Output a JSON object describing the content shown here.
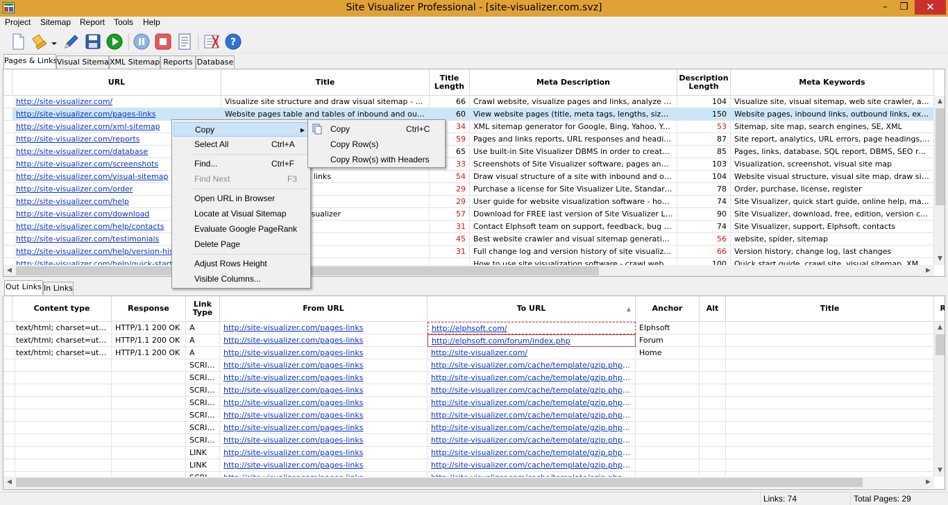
{
  "window": {
    "title": "Site Visualizer Professional - [site-visualizer.com.svz]",
    "min": "–",
    "max": "❒",
    "close": "✕"
  },
  "menu": [
    "Project",
    "Sitemap",
    "Report",
    "Tools",
    "Help"
  ],
  "toolbar_icons": [
    "new-project-icon",
    "open-project-icon",
    "dropdown-arrow-icon",
    "edit-project-icon",
    "save-project-icon",
    "start-crawl-icon",
    "pause-crawl-icon",
    "stop-crawl-icon",
    "report-icon",
    "settings-icon",
    "help-icon"
  ],
  "main_tabs": [
    "Pages & Links",
    "Visual Sitemap",
    "XML Sitemap",
    "Reports",
    "Database"
  ],
  "pages": {
    "columns": [
      "URL",
      "Title",
      "Title Length",
      "Meta Description",
      "Description Length",
      "Meta Keywords"
    ],
    "rows": [
      [
        "http://site-visualizer.com/",
        "Visualize site structure and draw visual sitemap - Site Visu...",
        "66",
        "Crawl website, visualize pages and links, analyze the stru...",
        "104",
        "Visualize site, visual sitemap, web site crawler, analyze w..."
      ],
      [
        "http://site-visualizer.com/pages-links",
        "Website pages table and tables of inbound and outbound ...",
        "60",
        "View website pages (title, meta tags, lengths, size, conte...",
        "150",
        "Website pages, inbound links, outbound links, external lin..."
      ],
      [
        "http://site-visualizer.com/xml-sitemap",
        "",
        "34",
        "XML sitemap generator for Google, Bing, Yahoo, Yandex",
        "53",
        "Sitemap, site map, search engines, SE, XML"
      ],
      [
        "http://site-visualizer.com/reports",
        "",
        "59",
        "Pages and links reports, URL responses and headings H1-...",
        "87",
        "Site report, analytics, URL errors, page headings, SEO, s..."
      ],
      [
        "http://site-visualizer.com/database",
        "",
        "65",
        "Use built-in Site Visualizer DBMS in order to create your cu...",
        "85",
        "Pages, links, database, SQL report, DBMS, SEO report"
      ],
      [
        "http://site-visualizer.com/screenshots",
        "",
        "33",
        "Screenshots of Site Visualizer software, pages and links ta...",
        "103",
        "Visualization, screenshot, visual site map"
      ],
      [
        "http://site-visualizer.com/visual-sitemap",
        "tically draw pages and links",
        "54",
        "Draw visual structure of a site with inbound and outbound...",
        "104",
        "Website visual structure, visual site map, draw site, analy..."
      ],
      [
        "http://site-visualizer.com/order",
        "e",
        "29",
        "Purchase a license for Site Visualizer Lite, Standard, or Pr...",
        "78",
        "Order, purchase, license, register"
      ],
      [
        "http://site-visualizer.com/help",
        "al",
        "29",
        "User guide for website visualization software - how to use...",
        "74",
        "Site Visualizer, quick start guide, online help, manual"
      ],
      [
        "http://site-visualizer.com/download",
        "ation software - Site Visualizer",
        "57",
        "Download for FREE last version of Site Visualizer Lite, Sta...",
        "90",
        "Site Visualizer, download, free, edition, version comparison"
      ],
      [
        "http://site-visualizer.com/help/contacts",
        "port",
        "31",
        "Contact Elphsoft team on support, feedback, bug report ...",
        "74",
        "Site Visualizer, support, Elphsoft, contacts"
      ],
      [
        "http://site-visualizer.com/testimonials",
        "nd website analysis",
        "45",
        "Best website crawler and visual sitemap generation tool!",
        "56",
        "website, spider, sitemap"
      ],
      [
        "http://site-visualizer.com/help/version-history",
        "ory",
        "31",
        "Full change log and version history of site visualization sof...",
        "66",
        "Version history, change log, last changes"
      ],
      [
        "http://site-visualizer.com/help/quick-start-guide",
        "ualizer",
        "",
        "How to use site visualization software - crawl website, cre...",
        "100",
        "Quick start guide, crawl site, visual sitemap, XML sitemap..."
      ]
    ],
    "red_title_len": [
      false,
      false,
      true,
      true,
      false,
      true,
      true,
      true,
      true,
      true,
      true,
      true,
      true,
      false
    ],
    "red_desc_len": [
      false,
      false,
      true,
      false,
      false,
      false,
      false,
      false,
      false,
      false,
      false,
      true,
      true,
      false
    ]
  },
  "link_tabs": [
    "Out Links",
    "In Links"
  ],
  "links": {
    "columns": [
      "Content type",
      "Response",
      "Link Type",
      "From URL",
      "To URL",
      "Anchor",
      "Alt",
      "Title",
      "R"
    ],
    "rows": [
      [
        "text/html; charset=utf-8",
        "HTTP/1.1 200 OK",
        "A",
        "http://site-visualizer.com/pages-links",
        "http://elphsoft.com/",
        "Elphsoft",
        "",
        ""
      ],
      [
        "text/html; charset=utf-8",
        "HTTP/1.1 200 OK",
        "A",
        "http://site-visualizer.com/pages-links",
        "http://elphsoft.com/forum/index.php",
        "Forum",
        "",
        ""
      ],
      [
        "text/html; charset=utf-8",
        "HTTP/1.1 200 OK",
        "A",
        "http://site-visualizer.com/pages-links",
        "http://site-visualizer.com/",
        "Home",
        "",
        ""
      ],
      [
        "",
        "",
        "SCRIPT",
        "http://site-visualizer.com/pages-links",
        "http://site-visualizer.com/cache/template/gzip.php?core-1...",
        "",
        "",
        ""
      ],
      [
        "",
        "",
        "SCRIPT",
        "http://site-visualizer.com/pages-links",
        "http://site-visualizer.com/cache/template/gzip.php?jquery...",
        "",
        "",
        ""
      ],
      [
        "",
        "",
        "SCRIPT",
        "http://site-visualizer.com/pages-links",
        "http://site-visualizer.com/cache/template/gzip.php?jquery...",
        "",
        "",
        ""
      ],
      [
        "",
        "",
        "SCRIPT",
        "http://site-visualizer.com/pages-links",
        "http://site-visualizer.com/cache/template/gzip.php?jquery...",
        "",
        "",
        ""
      ],
      [
        "",
        "",
        "SCRIPT",
        "http://site-visualizer.com/pages-links",
        "http://site-visualizer.com/cache/template/gzip.php?mooto...",
        "",
        "",
        ""
      ],
      [
        "",
        "",
        "SCRIPT",
        "http://site-visualizer.com/pages-links",
        "http://site-visualizer.com/cache/template/gzip.php?tabs-s...",
        "",
        "",
        ""
      ],
      [
        "",
        "",
        "SCRIPT",
        "http://site-visualizer.com/pages-links",
        "http://site-visualizer.com/cache/template/gzip.php?theme...",
        "",
        "",
        ""
      ],
      [
        "",
        "",
        "LINK",
        "http://site-visualizer.com/pages-links",
        "http://site-visualizer.com/cache/template/gzip.php?theme...",
        "",
        "",
        ""
      ],
      [
        "",
        "",
        "LINK",
        "http://site-visualizer.com/pages-links",
        "http://site-visualizer.com/cache/template/gzip.php?widge...",
        "",
        "",
        ""
      ],
      [
        "",
        "",
        "SCRIPT",
        "http://site-visualizer.com/pages-links",
        "http://site-visualizer.com/cache/template/gzip.php?jquery...",
        "",
        "",
        ""
      ]
    ]
  },
  "context_menu": {
    "items": [
      {
        "label": "Copy",
        "shortcut": ""
      },
      {
        "label": "Select All",
        "shortcut": "Ctrl+A"
      },
      {
        "label": "Find...",
        "shortcut": "Ctrl+F"
      },
      {
        "label": "Find Next",
        "shortcut": "F3"
      },
      {
        "label": "Open URL in Browser",
        "shortcut": ""
      },
      {
        "label": "Locate at Visual Sitemap",
        "shortcut": ""
      },
      {
        "label": "Evaluate Google PageRank",
        "shortcut": ""
      },
      {
        "label": "Delete Page",
        "shortcut": ""
      },
      {
        "label": "Adjust Rows Height",
        "shortcut": ""
      },
      {
        "label": "Visible Columns...",
        "shortcut": ""
      }
    ]
  },
  "submenu": {
    "items": [
      {
        "label": "Copy",
        "shortcut": "Ctrl+C"
      },
      {
        "label": "Copy Row(s)",
        "shortcut": ""
      },
      {
        "label": "Copy Row(s) with Headers",
        "shortcut": ""
      }
    ]
  },
  "status": {
    "links": "Links: 74",
    "total_pages": "Total Pages: 29"
  },
  "colors": {
    "titlebar": "#e0a236",
    "selection": "#cde6f7",
    "link": "#0b33c4",
    "red_value": "#e01010",
    "close": "#c7302d"
  }
}
